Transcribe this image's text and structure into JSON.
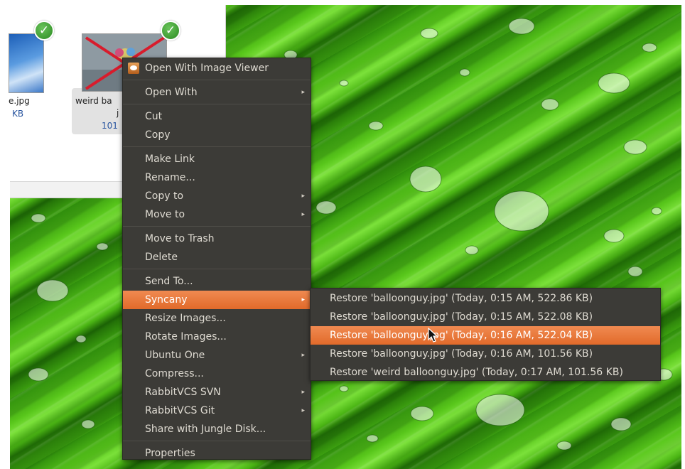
{
  "files": [
    {
      "name": "e.jpg",
      "size": "KB"
    },
    {
      "name": "weird ba",
      "name_line2": "j",
      "size": "101"
    }
  ],
  "context_menu": {
    "items": [
      {
        "label": "Open With Image Viewer",
        "icon": "image-viewer-icon"
      },
      {
        "separator": true
      },
      {
        "label": "Open With",
        "submenu": true
      },
      {
        "separator": true
      },
      {
        "label": "Cut"
      },
      {
        "label": "Copy"
      },
      {
        "separator": true
      },
      {
        "label": "Make Link"
      },
      {
        "label": "Rename..."
      },
      {
        "label": "Copy to",
        "submenu": true
      },
      {
        "label": "Move to",
        "submenu": true
      },
      {
        "separator": true
      },
      {
        "label": "Move to Trash"
      },
      {
        "label": "Delete"
      },
      {
        "separator": true
      },
      {
        "label": "Send To..."
      },
      {
        "label": "Syncany",
        "submenu": true,
        "active": true
      },
      {
        "label": "Resize Images..."
      },
      {
        "label": "Rotate Images..."
      },
      {
        "label": "Ubuntu One",
        "submenu": true
      },
      {
        "label": "Compress..."
      },
      {
        "label": "RabbitVCS SVN",
        "submenu": true
      },
      {
        "label": "RabbitVCS Git",
        "submenu": true
      },
      {
        "label": "Share with Jungle Disk..."
      },
      {
        "separator": true
      },
      {
        "label": "Properties"
      }
    ]
  },
  "syncany_submenu": {
    "items": [
      {
        "label": "Restore 'balloonguy.jpg' (Today, 0:15 AM, 522.86 KB)"
      },
      {
        "label": "Restore 'balloonguy.jpg' (Today, 0:15 AM, 522.08 KB)"
      },
      {
        "label": "Restore 'balloonguy.jpg' (Today, 0:16 AM, 522.04 KB)",
        "active": true
      },
      {
        "label": "Restore 'balloonguy.jpg' (Today, 0:16 AM, 101.56 KB)"
      },
      {
        "label": "Restore 'weird balloonguy.jpg' (Today, 0:17 AM, 101.56 KB)"
      }
    ]
  },
  "colors": {
    "menu_bg": "#3c3b37",
    "menu_text": "#dfdbd2",
    "highlight": "#e7763a",
    "sync_badge": "#3a9a2e"
  }
}
